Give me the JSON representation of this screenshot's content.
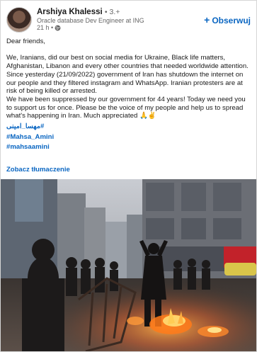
{
  "author": {
    "name": "Arshiya Khalessi",
    "degree": "• 3.+",
    "headline": "Oracle database Dev Engineer at ING",
    "time": "21 h •",
    "visibility_icon": "globe-icon"
  },
  "follow_button": {
    "icon": "plus-icon",
    "label": "Obserwuj"
  },
  "post": {
    "greeting": "Dear friends,",
    "paragraph1": "We, Iranians, did our best on social media for Ukraine, Black life matters, Afghanistan, Libanon and every other countries that needed worldwide attention. Since yesterday (21/09/2022) government of Iran has shutdown the internet on our people and they filtered instagram and WhatsApp. Iranian protesters are at risk of being killed or arrested.",
    "paragraph2": "We have been suppressed by our government for 44 years! Today we need you to support us for once. Please be the voice of my people and help us to spread what's happening in Iran. Much appreciated 🙏✌",
    "hashtags": [
      "#مهسا_امینی",
      "#Mahsa_Amini",
      "#mahsaamini"
    ]
  },
  "translate_link": "Zobacz tłumaczenie",
  "colors": {
    "accent": "#0a66c2",
    "text": "#191919",
    "muted": "#666666"
  }
}
